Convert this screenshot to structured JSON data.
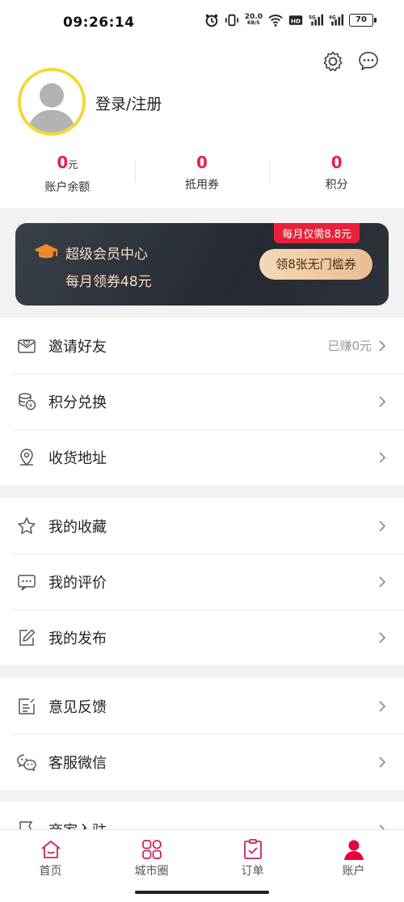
{
  "status_bar": {
    "time": "09:26:14",
    "net_speed_value": "20.0",
    "net_speed_unit": "KB/S",
    "hd": "HD",
    "sim1": "5G",
    "sim2": "4G",
    "battery": "70"
  },
  "profile": {
    "login_text": "登录/注册"
  },
  "stats": [
    {
      "value": "0",
      "unit": "元",
      "label": "账户余额"
    },
    {
      "value": "0",
      "unit": "",
      "label": "抵用券"
    },
    {
      "value": "0",
      "unit": "",
      "label": "积分"
    }
  ],
  "vip_banner": {
    "title": "超级会员中心",
    "subtitle": "每月领券48元",
    "badge": "每月仅需8.8元",
    "button": "领8张无门槛券"
  },
  "menu_groups": {
    "group1": [
      {
        "label": "邀请好友",
        "extra": "已赚0元",
        "icon": "envelope-heart-icon"
      },
      {
        "label": "积分兑换",
        "extra": "",
        "icon": "coins-icon"
      },
      {
        "label": "收货地址",
        "extra": "",
        "icon": "location-pin-icon"
      }
    ],
    "group2": [
      {
        "label": "我的收藏",
        "icon": "star-icon"
      },
      {
        "label": "我的评价",
        "icon": "comment-icon"
      },
      {
        "label": "我的发布",
        "icon": "edit-icon"
      }
    ],
    "group3": [
      {
        "label": "意见反馈",
        "icon": "feedback-icon"
      },
      {
        "label": "客服微信",
        "icon": "wechat-icon"
      }
    ],
    "group4": [
      {
        "label": "商家入驻",
        "icon": "flag-icon"
      }
    ]
  },
  "tabbar": [
    {
      "label": "首页",
      "icon": "home-icon",
      "active": false
    },
    {
      "label": "城市圈",
      "icon": "city-circle-icon",
      "active": false
    },
    {
      "label": "订单",
      "icon": "order-icon",
      "active": false
    },
    {
      "label": "账户",
      "icon": "account-icon",
      "active": true
    }
  ],
  "colors": {
    "accent": "#e8234b",
    "tab_icon": "#c9275e",
    "vip_text": "#f6dcc1",
    "avatar_border": "#f1da3a"
  }
}
